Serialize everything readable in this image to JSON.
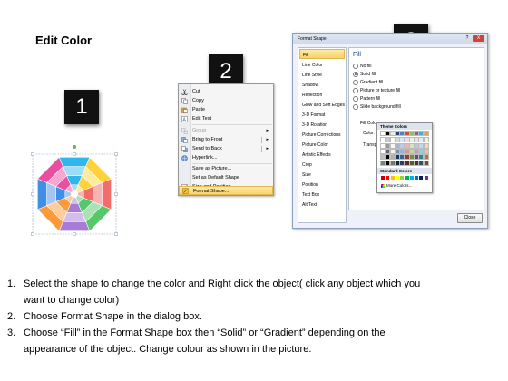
{
  "title": "Edit Color",
  "badges": [
    "1",
    "2",
    "3"
  ],
  "context_menu": {
    "items": [
      {
        "label": "Cut",
        "icon": "scissors-icon",
        "disabled": false
      },
      {
        "label": "Copy",
        "icon": "copy-icon",
        "disabled": false
      },
      {
        "label": "Paste",
        "icon": "paste-icon",
        "disabled": false
      },
      {
        "label": "Edit Text",
        "icon": "edit-text-icon",
        "disabled": false
      },
      {
        "label": "Group",
        "icon": "group-icon",
        "disabled": true
      },
      {
        "label": "Bring to Front",
        "icon": "bring-front-icon",
        "disabled": false
      },
      {
        "label": "Send to Back",
        "icon": "send-back-icon",
        "disabled": false
      },
      {
        "label": "Hyperlink...",
        "icon": "hyperlink-icon",
        "disabled": false
      },
      {
        "label": "Save as Picture...",
        "icon": "",
        "disabled": false
      },
      {
        "label": "Set as Default Shape",
        "icon": "",
        "disabled": false
      },
      {
        "label": "Size and Position...",
        "icon": "size-position-icon",
        "disabled": false
      },
      {
        "label": "Format Shape...",
        "icon": "format-shape-icon",
        "disabled": false
      }
    ]
  },
  "dialog": {
    "title": "Format Shape",
    "help": "?",
    "close_x": "X",
    "nav": [
      "Fill",
      "Line Color",
      "Line Style",
      "Shadow",
      "Reflection",
      "Glow and Soft Edges",
      "3-D Format",
      "3-D Rotation",
      "Picture Corrections",
      "Picture Color",
      "Artistic Effects",
      "Crop",
      "Size",
      "Position",
      "Text Box",
      "Alt Text"
    ],
    "selected_nav": "Fill",
    "panel_heading": "Fill",
    "options": [
      {
        "label": "No fill",
        "checked": false
      },
      {
        "label": "Solid fill",
        "checked": true
      },
      {
        "label": "Gradient fill",
        "checked": false
      },
      {
        "label": "Picture or texture fill",
        "checked": false
      },
      {
        "label": "Pattern fill",
        "checked": false
      },
      {
        "label": "Slide background fill",
        "checked": false
      }
    ],
    "fill_color_label": "Fill Color",
    "color_label": "Color:",
    "transparency_label": "Transpa",
    "close_button": "Close"
  },
  "palette": {
    "theme_title": "Theme Colors",
    "standard_title": "Standard Colors",
    "more_colors": "More Colors...",
    "theme_top": [
      "#ffffff",
      "#000000",
      "#eeece1",
      "#1f497d",
      "#4f81bd",
      "#c0504d",
      "#9bbb59",
      "#8064a2",
      "#4bacc6",
      "#f79646"
    ],
    "standard": [
      "#c00000",
      "#ff0000",
      "#ffc000",
      "#ffff00",
      "#92d050",
      "#00b050",
      "#00b0f0",
      "#0070c0",
      "#002060",
      "#7030a0"
    ]
  },
  "instructions": [
    {
      "num": "1.",
      "lines": [
        "Select the shape to change the color and Right click the object( click any object which you",
        "want to change color)"
      ]
    },
    {
      "num": "2.",
      "lines": [
        "Choose Format Shape in the dialog box."
      ]
    },
    {
      "num": "3.",
      "lines": [
        "Choose “Fill” in the Format Shape box then “Solid” or “Gradient” depending on the",
        "appearance of the object. Change colour as shown in the picture."
      ]
    }
  ]
}
